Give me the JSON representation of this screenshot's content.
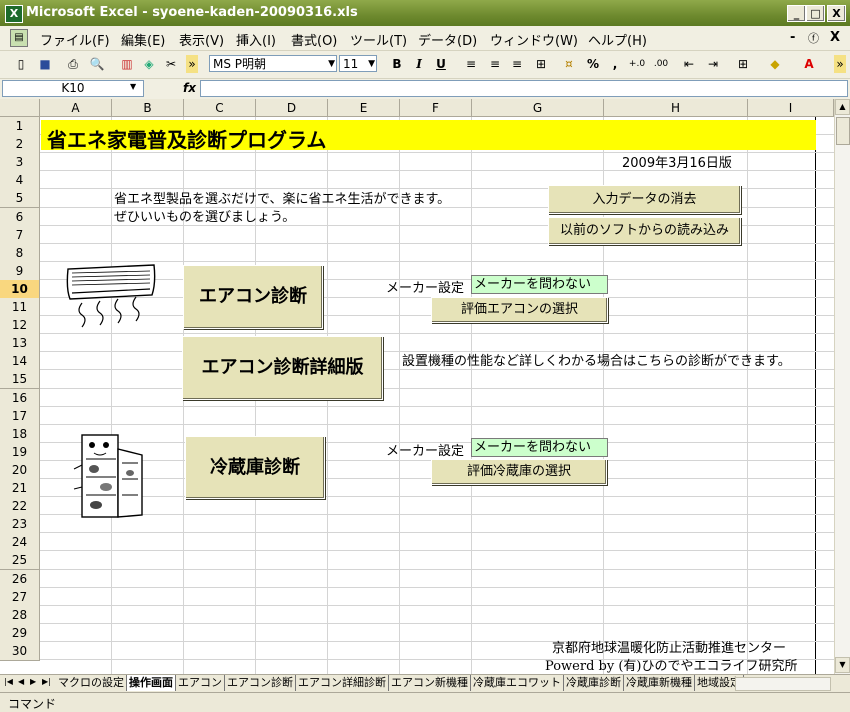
{
  "window": {
    "title": "Microsoft Excel - syoene-kaden-20090316.xls",
    "app_icon": "excel-icon",
    "controls": [
      "_",
      "□",
      "X"
    ]
  },
  "menu": {
    "items": [
      "ファイル(F)",
      "編集(E)",
      "表示(V)",
      "挿入(I)",
      "書式(O)",
      "ツール(T)",
      "データ(D)",
      "ウィンドウ(W)",
      "ヘルプ(H)"
    ],
    "doc_controls": [
      "-",
      "ⓕ",
      "X"
    ]
  },
  "toolbar": {
    "font_name": "MS P明朝",
    "font_size": "11",
    "bold": "B",
    "italic": "I",
    "underline": "U",
    "percent": "%",
    "comma": ","
  },
  "formula_bar": {
    "name_box": "K10",
    "fx": "fx",
    "value": ""
  },
  "columns": [
    "A",
    "B",
    "C",
    "D",
    "E",
    "F",
    "G",
    "H",
    "I"
  ],
  "rows": [
    "1",
    "2",
    "3",
    "4",
    "5",
    "6",
    "7",
    "8",
    "9",
    "10",
    "11",
    "12",
    "13",
    "14",
    "15",
    "16",
    "17",
    "18",
    "19",
    "20",
    "21",
    "22",
    "23",
    "24",
    "25",
    "26",
    "27",
    "28",
    "29",
    "30"
  ],
  "active_row": "10",
  "sheet": {
    "title": "省エネ家電普及診断プログラム",
    "version": "2009年3月16日版",
    "intro_line1": "省エネ型製品を選ぶだけで、楽に省エネ生活ができます。",
    "intro_line2": "ぜひいいものを選びましょう。",
    "clear_button": "入力データの消去",
    "import_button": "以前のソフトからの読み込み",
    "aircon_button": "エアコン診断",
    "aircon_detail_button": "エアコン診断詳細版",
    "aircon_detail_note": "設置機種の性能など詳しくわかる場合はこちらの診断ができます。",
    "maker_label1": "メーカー設定",
    "maker_value1": "メーカーを問わない",
    "select_aircon_button": "評価エアコンの選択",
    "fridge_button": "冷蔵庫診断",
    "maker_label2": "メーカー設定",
    "maker_value2": "メーカーを問わない",
    "select_fridge_button": "評価冷蔵庫の選択",
    "footer_org": "京都府地球温暖化防止活動推進センター",
    "footer_powered": "Powerd by (有)ひのでやエコライフ研究所"
  },
  "sheet_tabs": [
    "マクロの設定",
    "操作画面",
    "エアコン",
    "エアコン診断",
    "エアコン詳細診断",
    "エアコン新機種",
    "冷蔵庫エコワット",
    "冷蔵庫診断",
    "冷蔵庫新機種",
    "地域設定"
  ],
  "active_tab": "操作画面",
  "status": "コマンド",
  "colors": {
    "title_band": "#ffff00",
    "button_face": "#e6e3b8",
    "maker_field": "#ccffcc",
    "titlebar": "#6e8a2e"
  }
}
